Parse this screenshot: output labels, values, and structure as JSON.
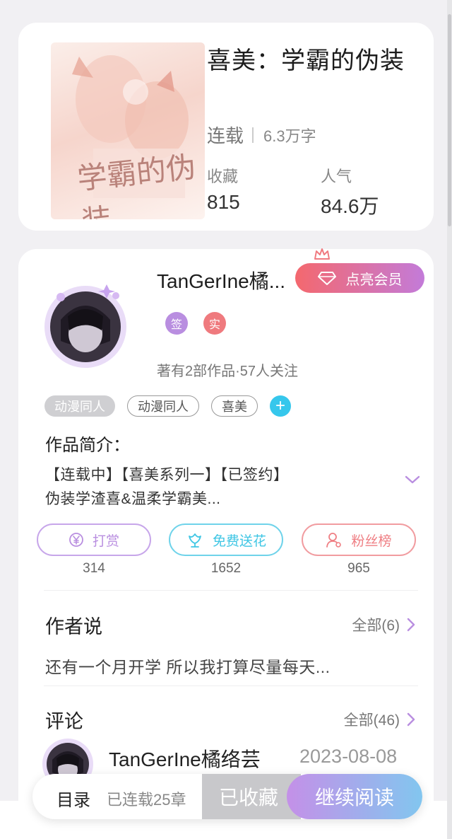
{
  "book": {
    "title": "喜美：学霸的伪装",
    "status": "连载",
    "word_count": "6.3万字",
    "favorites_label": "收藏",
    "favorites_value": "815",
    "popularity_label": "人气",
    "popularity_value": "84.6万",
    "cover_text": "学霸的伪装"
  },
  "author": {
    "name": "TanGerIne橘...",
    "member_button": "点亮会员",
    "badge_signed": "签",
    "badge_verified": "实",
    "meta": "著有2部作品·57人关注"
  },
  "tags": [
    "动漫同人",
    "动漫同人",
    "喜美"
  ],
  "intro": {
    "title": "作品简介：",
    "line1": "【连载中】【喜美系列一】【已签约】",
    "line2": "伪装学渣喜&温柔学霸美..."
  },
  "actions": [
    {
      "label": "打赏",
      "count": "314",
      "color": "#b98ee0"
    },
    {
      "label": "免费送花",
      "count": "1652",
      "color": "#3fc6e4"
    },
    {
      "label": "粉丝榜",
      "count": "965",
      "color": "#ef7f84"
    }
  ],
  "author_says": {
    "title": "作者说",
    "more": "全部(6)",
    "content": "还有一个月开学 所以我打算尽量每天..."
  },
  "comments": {
    "title": "评论",
    "more": "全部(46)",
    "first_name": "TanGerIne橘络芸",
    "first_date": "2023-08-08"
  },
  "bottom": {
    "toc": "目录",
    "chapters": "已连载25章",
    "saved": "已收藏",
    "continue": "继续阅读"
  },
  "colors": {
    "accent_purple": "#b98ee0",
    "accent_cyan": "#3fc6e4",
    "accent_red": "#ef7f84"
  }
}
